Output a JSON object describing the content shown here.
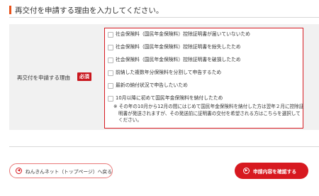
{
  "section": {
    "heading": "再交付を申請する理由を入力してください。",
    "accent_color": "#e8521a"
  },
  "form": {
    "label": "再交付を申請する理由",
    "required_badge": "必須",
    "options": [
      {
        "label": "社会保険料（国民年金保険料）控除証明書が届いていないため"
      },
      {
        "label": "社会保険料（国民年金保険料）控除証明書を紛失したため"
      },
      {
        "label": "社会保険料（国民年金保険料）控除証明書を破損したため"
      },
      {
        "label": "前納した複数年分保険料を分割して申告するため"
      },
      {
        "label": "最新の納付状況で申告したいため"
      },
      {
        "label": "10月以降に初めて国民年金保険料を納付したため"
      }
    ],
    "note": "※ その年の10月から12月の間にはじめて国民年金保険料を納付した方は翌年２月に控除証明書が発送されますが、その発送前に証明書の交付を希望される方はこちらを選択してください。",
    "highlight_color": "#d71920"
  },
  "actions": {
    "back_label": "ねんきんネット（トップページ）へ戻る",
    "back_icon": "chevron-left-circle-icon",
    "confirm_label": "申請内容を確認する",
    "confirm_icon": "chevron-right-circle-icon",
    "confirm_color": "#d71920"
  }
}
